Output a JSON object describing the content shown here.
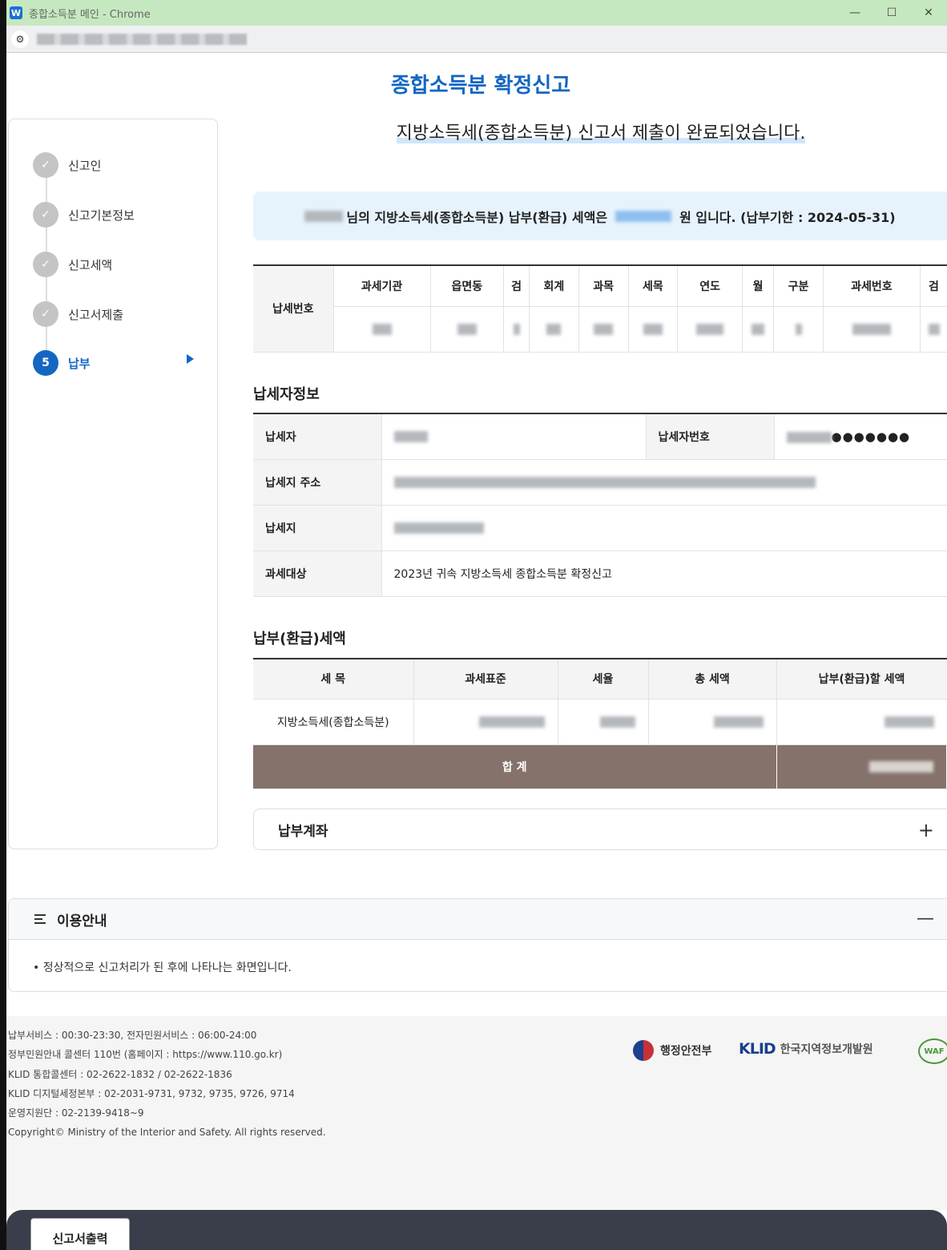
{
  "window": {
    "app_icon": "W",
    "title": "종합소득분 메인 - Chrome",
    "controls": [
      "—",
      "☐",
      "✕"
    ]
  },
  "page": {
    "title": "종합소득분 확정신고",
    "subtitle": "지방소득세(종합소득분) 신고서 제출이 완료되었습니다."
  },
  "steps": [
    {
      "label": "신고인",
      "state": "done"
    },
    {
      "label": "신고기본정보",
      "state": "done"
    },
    {
      "label": "신고세액",
      "state": "done"
    },
    {
      "label": "신고서제출",
      "state": "done"
    },
    {
      "label": "납부",
      "number": "5",
      "state": "active"
    }
  ],
  "notice": {
    "text_a": "님의 지방소득세(종합소득분) 납부(환급) 세액은",
    "text_b": "원 입니다. (납부기한 : 2024-05-31)"
  },
  "tax_number": {
    "row_header": "납세번호",
    "columns": [
      "과세기관",
      "읍면동",
      "검",
      "회계",
      "과목",
      "세목",
      "연도",
      "월",
      "구분",
      "과세번호",
      "검"
    ]
  },
  "payer_section": {
    "heading": "납세자정보",
    "rows": [
      {
        "label": "납세자",
        "label2": "납세자번호",
        "masked": "●●●●●●●"
      },
      {
        "label": "납세지 주소"
      },
      {
        "label": "납세지"
      },
      {
        "label": "과세대상",
        "value": "2023년 귀속 지방소득세 종합소득분 확정신고"
      }
    ]
  },
  "amount_section": {
    "heading": "납부(환급)세액",
    "headers": [
      "세 목",
      "과세표준",
      "세율",
      "총 세액",
      "납부(환급)할 세액"
    ],
    "row_label": "지방소득세(종합소득분)",
    "total_label": "합 계"
  },
  "account": {
    "label": "납부계좌",
    "toggle": "+"
  },
  "guide": {
    "title": "이용안내",
    "toggle": "—",
    "item": "• 정상적으로 신고처리가 된 후에 나타나는 화면입니다."
  },
  "footer": {
    "lines": [
      "납부서비스 : 00:30-23:30, 전자민원서비스 : 06:00-24:00",
      "정부민원안내 콜센터 110번 (홈페이지 : https://www.110.go.kr)",
      "KLID 통합콜센터 : 02-2622-1832 / 02-2622-1836",
      "KLID 디지털세정본부 : 02-2031-9731, 9732, 9735, 9726, 9714",
      "운영지원단 : 02-2139-9418~9",
      "Copyright© Ministry of the Interior and Safety. All rights reserved."
    ],
    "mois": "행정안전부",
    "klid_mark": "KLID",
    "klid_name": "한국지역정보개발원",
    "waf": "WAF"
  },
  "bottom": {
    "print_button": "신고서출력"
  },
  "colors": {
    "primary": "#1466c2",
    "total_row": "#85726b",
    "notice_bg": "#e6f3fd"
  }
}
